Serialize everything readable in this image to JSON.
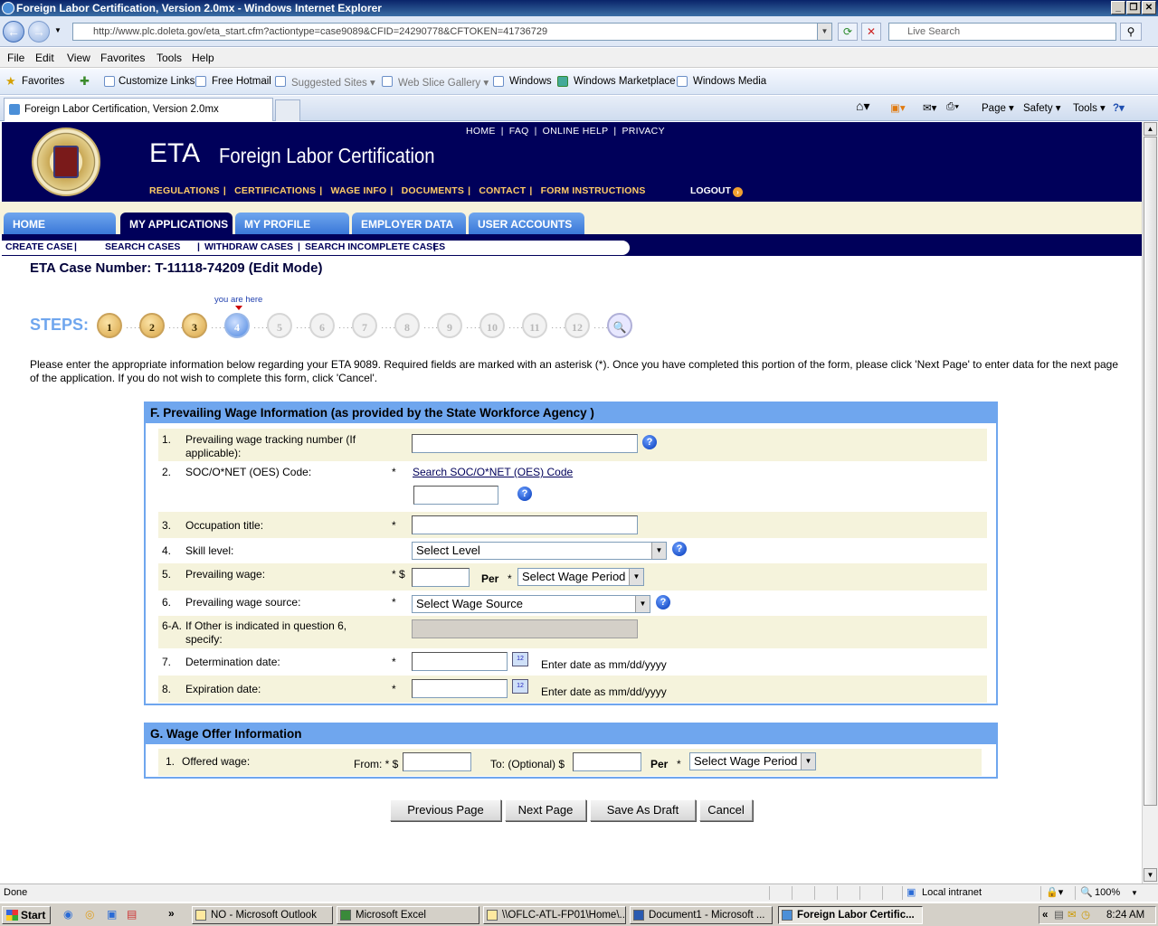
{
  "window": {
    "title": "Foreign Labor Certification, Version 2.0mx - Windows Internet Explorer"
  },
  "browser": {
    "url": "http://www.plc.doleta.gov/eta_start.cfm?actiontype=case9089&CFID=24290778&CFTOKEN=41736729",
    "search_placeholder": "Live Search",
    "menu": [
      "File",
      "Edit",
      "View",
      "Favorites",
      "Tools",
      "Help"
    ],
    "favorites_label": "Favorites",
    "favorites": [
      "Customize Links",
      "Free Hotmail",
      "Suggested Sites ▾",
      "Web Slice Gallery ▾",
      "Windows",
      "Windows Marketplace",
      "Windows Media"
    ],
    "tab_title": "Foreign Labor Certification, Version 2.0mx",
    "commands": [
      "Page ▾",
      "Safety ▾",
      "Tools ▾"
    ],
    "status": "Done",
    "zone": "Local intranet",
    "zoom": "100%"
  },
  "site": {
    "logo": "ETA",
    "title": "Foreign Labor Certification",
    "toplinks": [
      "HOME",
      "|",
      "FAQ",
      "|",
      "ONLINE HELP",
      "|",
      "PRIVACY"
    ],
    "navlinks": [
      "REGULATIONS",
      "CERTIFICATIONS",
      "WAGE INFO",
      "DOCUMENTS",
      "CONTACT",
      "FORM INSTRUCTIONS"
    ],
    "logout": "LOGOUT",
    "tabs": [
      "HOME",
      "MY APPLICATIONS",
      "MY PROFILE",
      "EMPLOYER DATA",
      "USER ACCOUNTS"
    ],
    "subnav": [
      "CREATE CASE",
      "SEARCH CASES",
      "WITHDRAW CASES",
      "SEARCH INCOMPLETE CASES"
    ]
  },
  "case": {
    "number": "ETA Case Number: T-11118-74209  (Edit Mode)"
  },
  "steps": {
    "label": "STEPS:",
    "you_are_here": "you are here",
    "items": [
      "1",
      "2",
      "3",
      "4",
      "5",
      "6",
      "7",
      "8",
      "9",
      "10",
      "11",
      "12"
    ],
    "current": 4
  },
  "instructions": "Please enter the appropriate information below regarding your ETA 9089. Required fields are marked with an asterisk (*). Once you have completed this portion of the form, please click 'Next Page' to enter data for the next page of the application. If you do not wish to complete this form, click 'Cancel'.",
  "sectionF": {
    "title": "F. Prevailing Wage Information (as provided by the State Workforce Agency )",
    "rows": [
      {
        "num": "1.",
        "label": "Prevailing wage tracking number (If applicable):"
      },
      {
        "num": "2.",
        "label": "SOC/O*NET (OES) Code:",
        "req": "*",
        "link": "Search SOC/O*NET (OES) Code"
      },
      {
        "num": "3.",
        "label": "Occupation title:",
        "req": "*"
      },
      {
        "num": "4.",
        "label": "Skill level:",
        "select": "Select Level"
      },
      {
        "num": "5.",
        "label": "Prevailing wage:",
        "req": "* $",
        "per": "Per",
        "per_req": "*",
        "select": "Select Wage Period"
      },
      {
        "num": "6.",
        "label": "Prevailing wage source:",
        "req": "*",
        "select": "Select Wage Source"
      },
      {
        "num": "6-A.",
        "label": "If Other is indicated in question 6, specify:"
      },
      {
        "num": "7.",
        "label": "Determination date:",
        "req": "*",
        "hint": "Enter date as mm/dd/yyyy"
      },
      {
        "num": "8.",
        "label": "Expiration date:",
        "req": "*",
        "hint": "Enter date as mm/dd/yyyy"
      }
    ]
  },
  "sectionG": {
    "title": "G. Wage Offer Information",
    "num": "1.",
    "label": "Offered wage:",
    "from": "From: * $",
    "to": "To: (Optional)  $",
    "per": "Per",
    "per_req": "*",
    "select": "Select Wage Period"
  },
  "buttons": [
    "Previous Page",
    "Next Page",
    "Save As Draft",
    "Cancel"
  ],
  "taskbar": {
    "start": "Start",
    "tasks": [
      "NO - Microsoft Outlook",
      "Microsoft Excel",
      "\\\\OFLC-ATL-FP01\\Home\\...",
      "Document1 - Microsoft ...",
      "Foreign Labor Certific..."
    ],
    "time": "8:24 AM"
  }
}
